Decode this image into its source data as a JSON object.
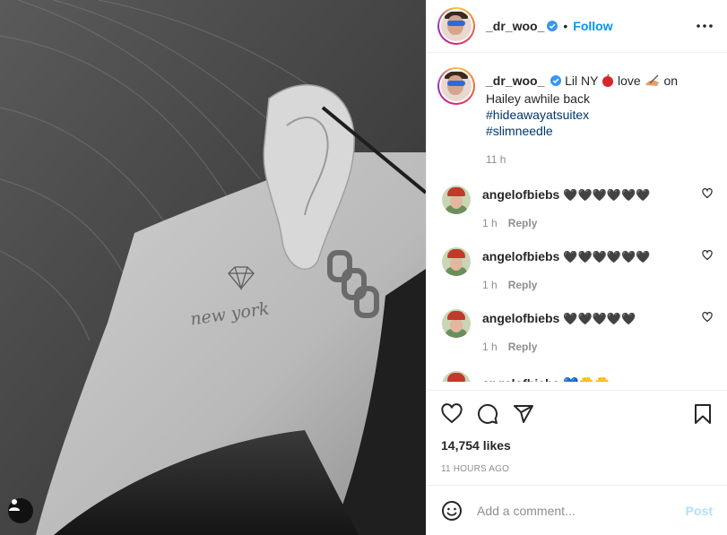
{
  "post": {
    "username": "_dr_woo_",
    "follow_label": "Follow",
    "separator": "•",
    "caption": {
      "text_before_emoji1": "Lil NY",
      "text_between_emojis": "love",
      "text_after_emoji2": "on Hailey awhile back",
      "hashtags": [
        "#hideawayatsuitex",
        "#slimneedle"
      ],
      "time": "11 h",
      "emoji1": "apple-emoji",
      "emoji2": "writing-hand-emoji"
    },
    "comments": [
      {
        "username": "angelofbiebs",
        "text": "🖤🖤🖤🖤🖤🖤",
        "time": "1 h",
        "reply_label": "Reply"
      },
      {
        "username": "angelofbiebs",
        "text": "🖤🖤🖤🖤🖤🖤",
        "time": "1 h",
        "reply_label": "Reply"
      },
      {
        "username": "angelofbiebs",
        "text": "🖤🖤🖤🖤🖤",
        "time": "1 h",
        "reply_label": "Reply"
      },
      {
        "username": "angelofbiebs",
        "text": "💙🌼🌼",
        "time": "",
        "reply_label": ""
      }
    ],
    "likes": "14,754 likes",
    "posted_ago": "11 HOURS AGO",
    "comment_placeholder": "Add a comment...",
    "post_label": "Post",
    "photo_tattoo_text": "new york"
  },
  "colors": {
    "accent": "#0095f6",
    "post_disabled": "#b2dffc",
    "hashtag": "#00376b",
    "muted": "#8e8e8e"
  },
  "icons": [
    "verified-badge-icon",
    "more-options-icon",
    "heart-icon",
    "comment-icon",
    "share-icon",
    "bookmark-icon",
    "emoji-smile-icon",
    "user-tag-icon"
  ]
}
